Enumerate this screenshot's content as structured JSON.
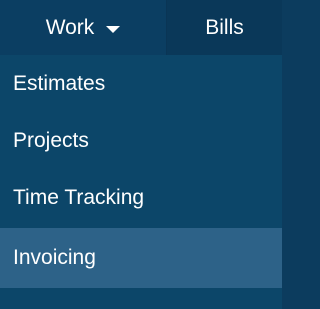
{
  "topbar": {
    "work_label": "Work",
    "bills_label": "Bills"
  },
  "dropdown": {
    "items": [
      {
        "label": "Estimates"
      },
      {
        "label": "Projects"
      },
      {
        "label": "Time Tracking"
      },
      {
        "label": "Invoicing",
        "active": true
      }
    ]
  },
  "colors": {
    "bar_bg": "#0a3b5d",
    "menu_bg": "#0c4669",
    "active_bg": "#2d6288",
    "text": "#ffffff"
  },
  "icons": {
    "work_caret": "chevron-down-icon"
  }
}
